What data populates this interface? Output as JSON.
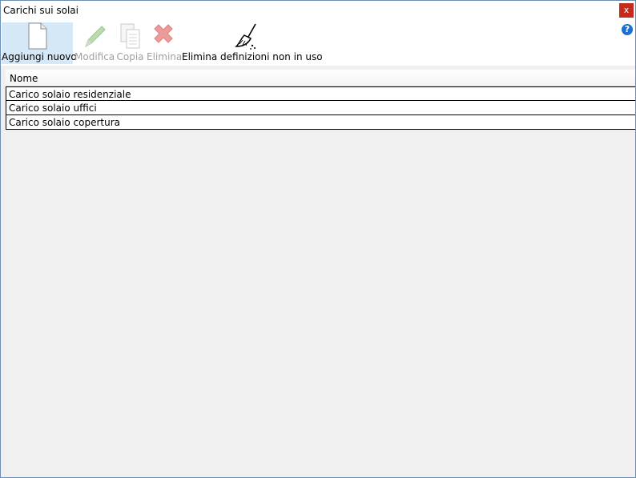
{
  "window": {
    "title": "Carichi sui solai",
    "close_label": "x",
    "help_label": "?"
  },
  "toolbar": {
    "add_label": "Aggiungi nuovo",
    "edit_label": "Modifica",
    "copy_label": "Copia",
    "delete_label": "Elimina",
    "clean_label": "Elimina definizioni non in uso"
  },
  "grid": {
    "header": "Nome",
    "rows": [
      "Carico solaio residenziale",
      "Carico solaio uffici",
      "Carico solaio copertura"
    ]
  },
  "colors": {
    "close": "#c42b1c",
    "active_tool": "#d5e8f8",
    "help": "#1d6fd0"
  }
}
